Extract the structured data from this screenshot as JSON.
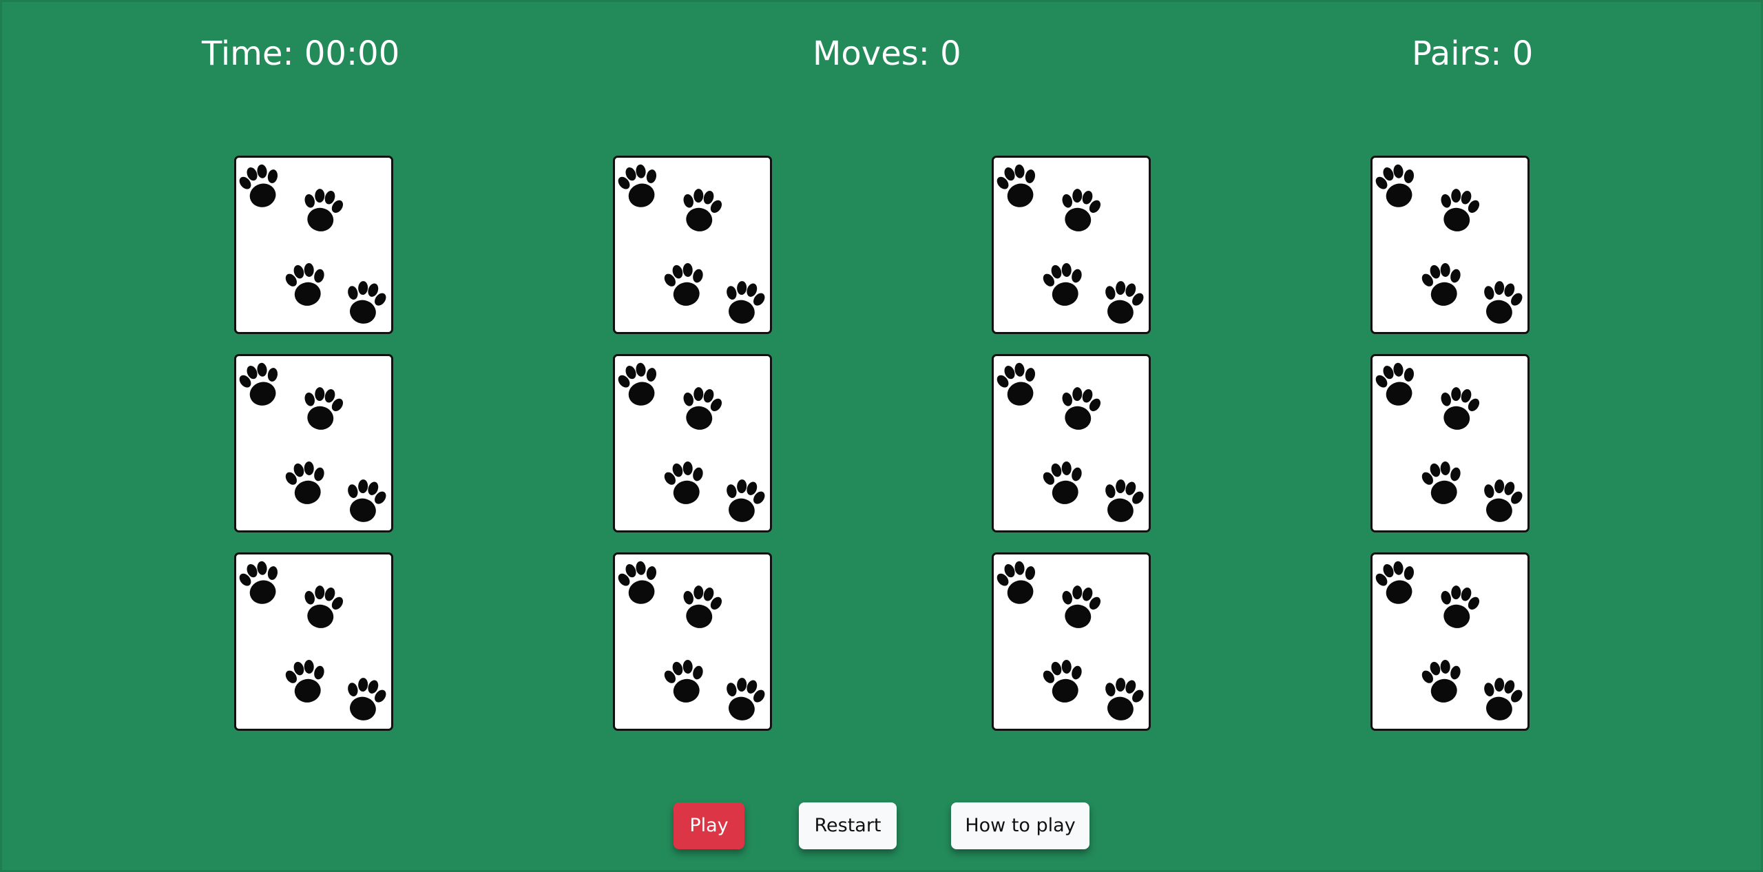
{
  "stats": {
    "time_text": "Time: 00:00",
    "moves_text": "Moves: 0",
    "pairs_text": "Pairs: 0"
  },
  "board": {
    "rows": 3,
    "columns": 4,
    "card_back": "paw-prints-icon",
    "cards_face_down": 12
  },
  "buttons": {
    "play_label": "Play",
    "restart_label": "Restart",
    "how_to_play_label": "How to play"
  },
  "colors": {
    "background": "#238a5a",
    "play_button": "#dc3545",
    "secondary_button": "#f8f9fa",
    "card_face": "#ffffff",
    "card_border": "#111111",
    "paw": "#0a0a0a",
    "text": "#ffffff"
  }
}
